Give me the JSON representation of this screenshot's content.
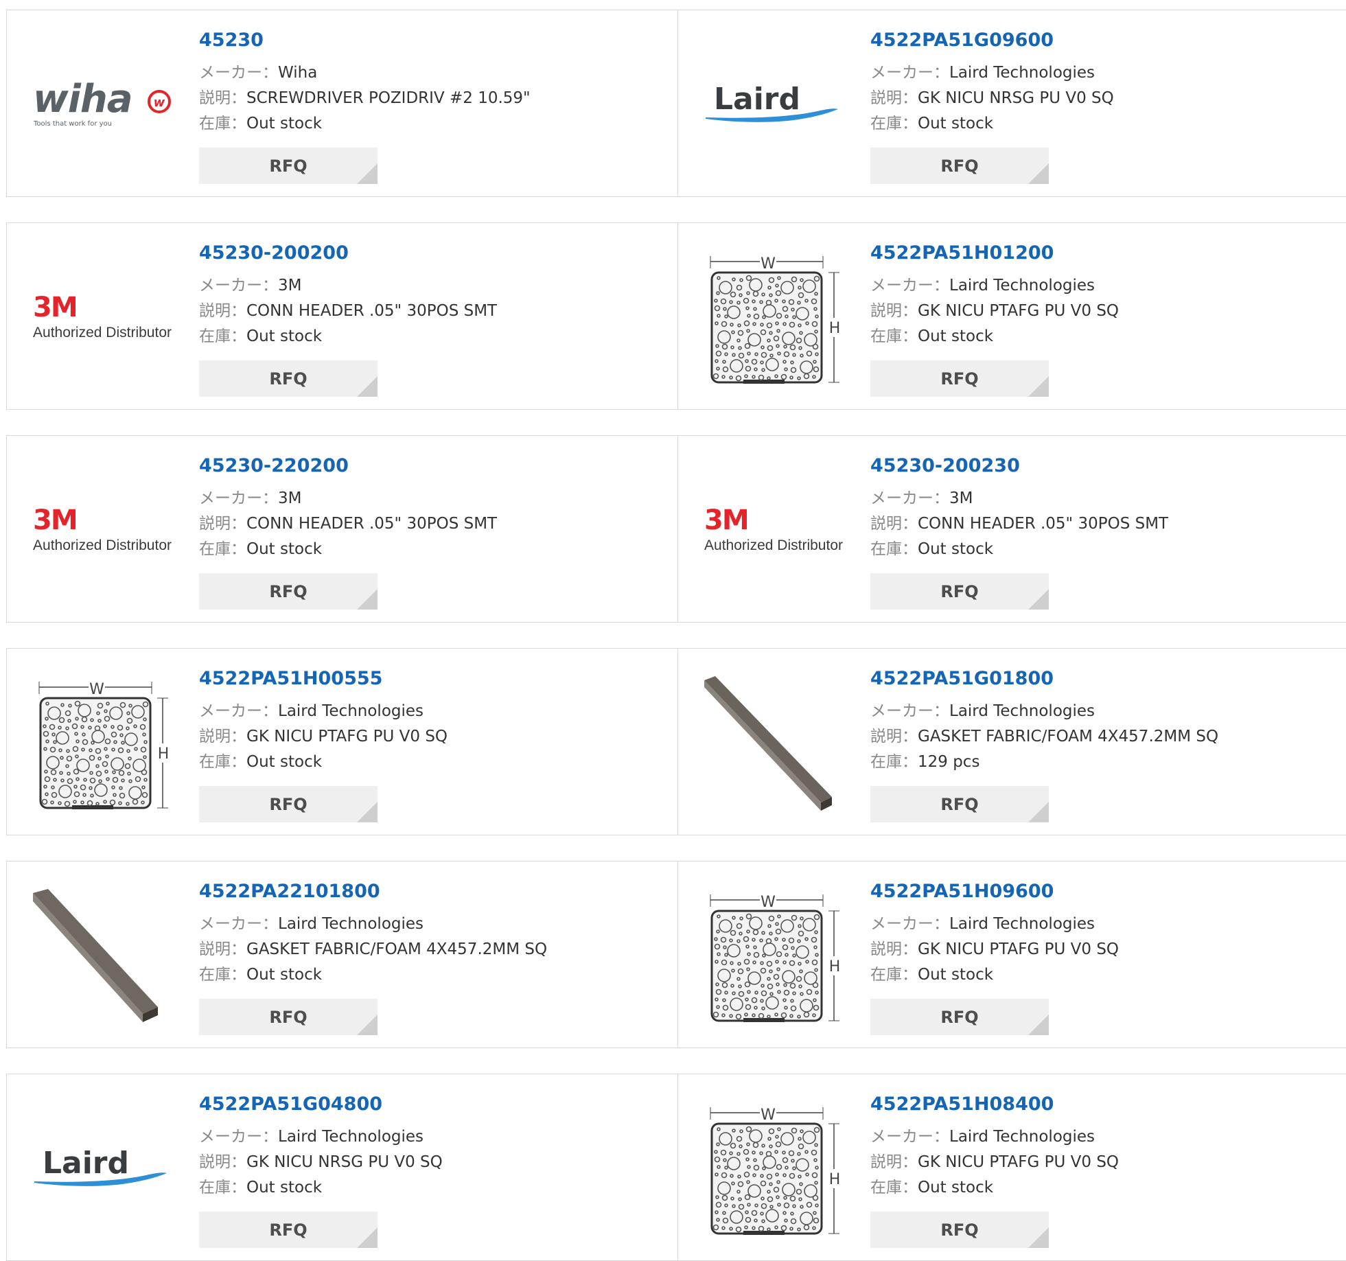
{
  "labels": {
    "maker": "メーカー：",
    "description": "説明：",
    "stock": "在庫："
  },
  "products": [
    {
      "part_number": "45230",
      "maker": "Wiha",
      "description": "SCREWDRIVER POZIDRIV #2 10.59\"",
      "stock": "Out stock",
      "rfq": "RFQ",
      "image": "wiha-logo"
    },
    {
      "part_number": "4522PA51G09600",
      "maker": "Laird Technologies",
      "description": "GK NICU NRSG PU V0 SQ",
      "stock": "Out stock",
      "rfq": "RFQ",
      "image": "laird-logo"
    },
    {
      "part_number": "45230-200200",
      "maker": "3M",
      "description": "CONN HEADER .05\" 30POS SMT",
      "stock": "Out stock",
      "rfq": "RFQ",
      "image": "3m-logo"
    },
    {
      "part_number": "4522PA51H01200",
      "maker": "Laird Technologies",
      "description": "GK NICU PTAFG PU V0 SQ",
      "stock": "Out stock",
      "rfq": "RFQ",
      "image": "gasket-diagram"
    },
    {
      "part_number": "45230-220200",
      "maker": "3M",
      "description": "CONN HEADER .05\" 30POS SMT",
      "stock": "Out stock",
      "rfq": "RFQ",
      "image": "3m-logo"
    },
    {
      "part_number": "45230-200230",
      "maker": "3M",
      "description": "CONN HEADER .05\" 30POS SMT",
      "stock": "Out stock",
      "rfq": "RFQ",
      "image": "3m-logo"
    },
    {
      "part_number": "4522PA51H00555",
      "maker": "Laird Technologies",
      "description": "GK NICU PTAFG PU V0 SQ",
      "stock": "Out stock",
      "rfq": "RFQ",
      "image": "gasket-diagram"
    },
    {
      "part_number": "4522PA51G01800",
      "maker": "Laird Technologies",
      "description": "GASKET FABRIC/FOAM 4X457.2MM SQ",
      "stock": "129 pcs",
      "rfq": "RFQ",
      "image": "gasket-strip-photo"
    },
    {
      "part_number": "4522PA22101800",
      "maker": "Laird Technologies",
      "description": "GASKET FABRIC/FOAM 4X457.2MM SQ",
      "stock": "Out stock",
      "rfq": "RFQ",
      "image": "gasket-strip-photo"
    },
    {
      "part_number": "4522PA51H09600",
      "maker": "Laird Technologies",
      "description": "GK NICU PTAFG PU V0 SQ",
      "stock": "Out stock",
      "rfq": "RFQ",
      "image": "gasket-diagram"
    },
    {
      "part_number": "4522PA51G04800",
      "maker": "Laird Technologies",
      "description": "GK NICU NRSG PU V0 SQ",
      "stock": "Out stock",
      "rfq": "RFQ",
      "image": "laird-logo"
    },
    {
      "part_number": "4522PA51H08400",
      "maker": "Laird Technologies",
      "description": "GK NICU PTAFG PU V0 SQ",
      "stock": "Out stock",
      "rfq": "RFQ",
      "image": "gasket-diagram"
    }
  ],
  "logos": {
    "wiha": {
      "wordmark": "wiha",
      "tagline": "Tools that work for you",
      "badge": "w"
    },
    "laird": {
      "wordmark": "Laird"
    },
    "threem": {
      "wordmark": "3M",
      "caption": "Authorized Distributor"
    },
    "diagram": {
      "width_label": "W",
      "height_label": "H"
    }
  },
  "colors": {
    "link": "#1565b4",
    "label": "#888888",
    "button_bg": "#efefef",
    "border": "#d9d9d9",
    "wiha_red": "#e3262a",
    "three_m_red": "#e3242b",
    "laird_blue": "#2d8fd5"
  }
}
